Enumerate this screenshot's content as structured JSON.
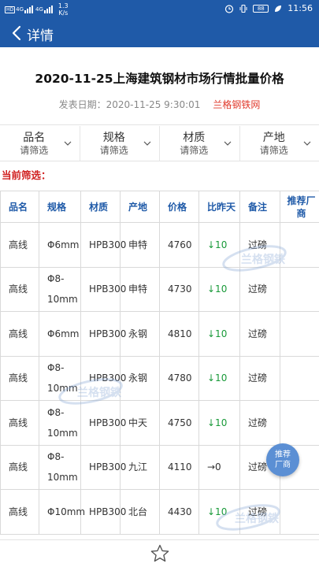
{
  "status_bar": {
    "network_left": "4G",
    "network_right": "4G",
    "speed_value": "1.3",
    "speed_unit": "K/s",
    "battery": "88",
    "time": "11:56"
  },
  "header": {
    "title": "详情"
  },
  "article": {
    "title": "2020-11-25上海建筑钢材市场行情批量价格",
    "date_label": "发表日期：",
    "date": "2020-11-25 9:30:01",
    "source": "兰格钢铁网"
  },
  "filters": [
    {
      "name": "品名",
      "select": "请筛选"
    },
    {
      "name": "规格",
      "select": "请筛选"
    },
    {
      "name": "材质",
      "select": "请筛选"
    },
    {
      "name": "产地",
      "select": "请筛选"
    }
  ],
  "current_filter_label": "当前筛选：",
  "table": {
    "headers": [
      "品名",
      "规格",
      "材质",
      "产地",
      "价格",
      "比昨天",
      "备注",
      "推荐厂商"
    ],
    "rows": [
      [
        "高线",
        "Φ6mm",
        "HPB300",
        "申特",
        "4760",
        "↓10",
        "过磅",
        ""
      ],
      [
        "高线",
        "Φ8-10mm",
        "HPB300",
        "申特",
        "4730",
        "↓10",
        "过磅",
        ""
      ],
      [
        "高线",
        "Φ6mm",
        "HPB300",
        "永钢",
        "4810",
        "↓10",
        "过磅",
        ""
      ],
      [
        "高线",
        "Φ8-10mm",
        "HPB300",
        "永钢",
        "4780",
        "↓10",
        "过磅",
        ""
      ],
      [
        "高线",
        "Φ8-10mm",
        "HPB300",
        "中天",
        "4750",
        "↓10",
        "过磅",
        ""
      ],
      [
        "高线",
        "Φ8-10mm",
        "HPB300",
        "九江",
        "4110",
        "→0",
        "过磅",
        ""
      ],
      [
        "高线",
        "Φ10mm",
        "HPB300",
        "北台",
        "4430",
        "↓10",
        "过磅",
        ""
      ]
    ]
  },
  "float_button": {
    "line1": "推荐",
    "line2": "厂商"
  },
  "watermark_text": "兰格钢铁",
  "colors": {
    "brand": "#1f5aa8",
    "down": "#1a9a3a",
    "accent": "#d02020"
  },
  "icons": {
    "back": "chevron-left-icon",
    "favorite": "star-icon"
  }
}
